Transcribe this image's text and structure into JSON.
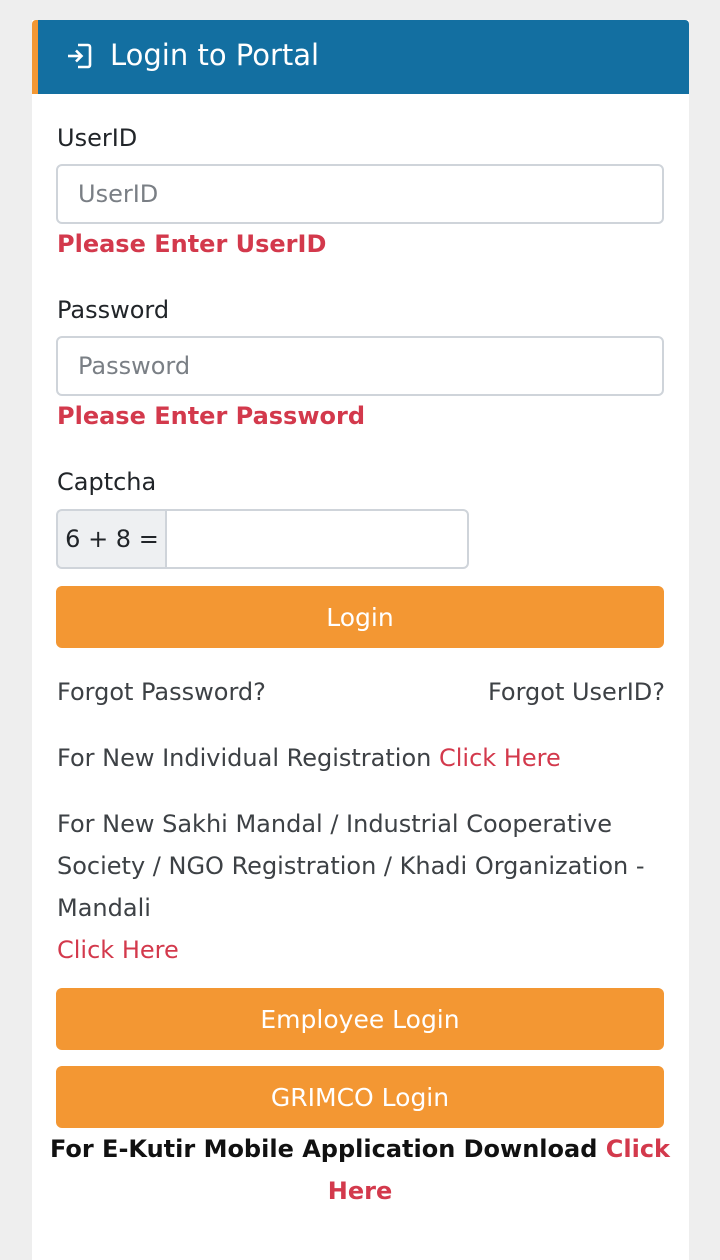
{
  "header": {
    "title": "Login to Portal",
    "icon": "sign-in-icon"
  },
  "form": {
    "userid": {
      "label": "UserID",
      "placeholder": "UserID",
      "error": "Please Enter UserID"
    },
    "password": {
      "label": "Password",
      "placeholder": "Password",
      "error": "Please Enter Password"
    },
    "captcha": {
      "label": "Captcha",
      "question": "6 + 8 =",
      "value": ""
    },
    "login_button": "Login"
  },
  "links": {
    "forgot_password": "Forgot Password?",
    "forgot_userid": "Forgot UserID?",
    "individual_text": "For New Individual Registration",
    "individual_link": "Click Here",
    "org_text": "For New Sakhi Mandal / Industrial Cooperative Society / NGO Registration / Khadi Organization - Mandali",
    "org_link": "Click Here"
  },
  "buttons": {
    "employee_login": "Employee Login",
    "grimco_login": "GRIMCO Login"
  },
  "footer": {
    "text": "For E-Kutir Mobile Application Download",
    "link": "Click Here"
  },
  "colors": {
    "header_bg": "#136fa1",
    "accent": "#f39733",
    "error": "#d3394c"
  }
}
